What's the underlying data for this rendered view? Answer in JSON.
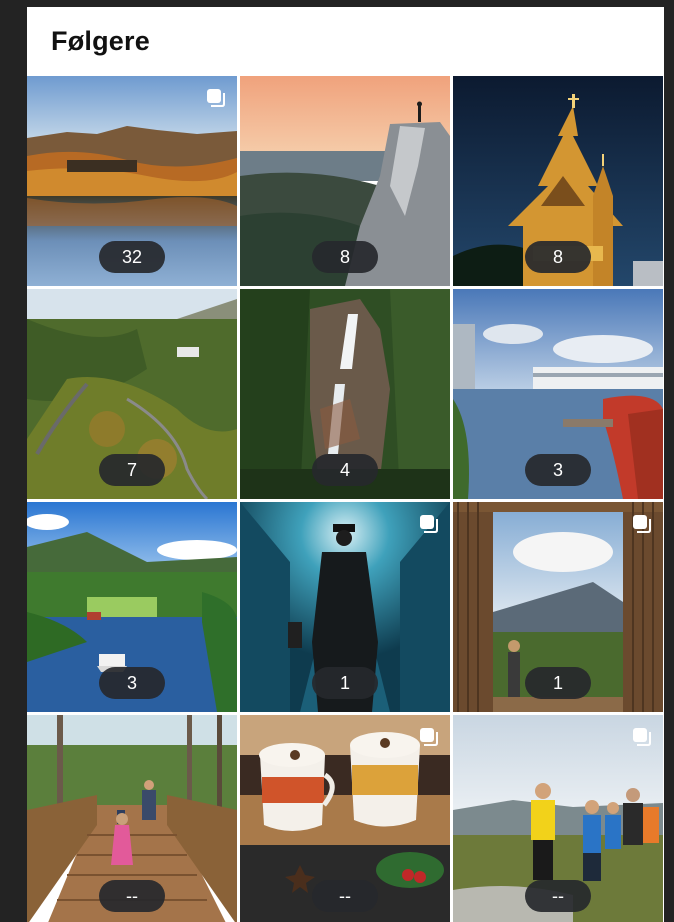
{
  "page": {
    "title": "Følgere"
  },
  "posts": [
    {
      "count": "32",
      "icon": "multiple-images-icon",
      "scene": "lake-autumn"
    },
    {
      "count": "8",
      "scene": "cliff-sunset"
    },
    {
      "count": "8",
      "scene": "stave-church-night"
    },
    {
      "count": "7",
      "scene": "valley-road"
    },
    {
      "count": "4",
      "scene": "waterfall-forest"
    },
    {
      "count": "3",
      "scene": "river-town"
    },
    {
      "count": "3",
      "scene": "fjord-boat"
    },
    {
      "count": "1",
      "icon": "multiple-images-icon",
      "scene": "tunnel-guard"
    },
    {
      "count": "1",
      "icon": "multiple-images-icon",
      "scene": "wooden-frame-view"
    },
    {
      "count": "--",
      "scene": "boardwalk-forest"
    },
    {
      "count": "--",
      "icon": "multiple-images-icon",
      "scene": "hot-chocolate"
    },
    {
      "count": "--",
      "icon": "multiple-images-icon",
      "scene": "family-hike"
    }
  ],
  "colors": {
    "background": "#232323",
    "panel": "#ffffff",
    "badge": "#26282c",
    "badge_text": "#ffffff"
  }
}
